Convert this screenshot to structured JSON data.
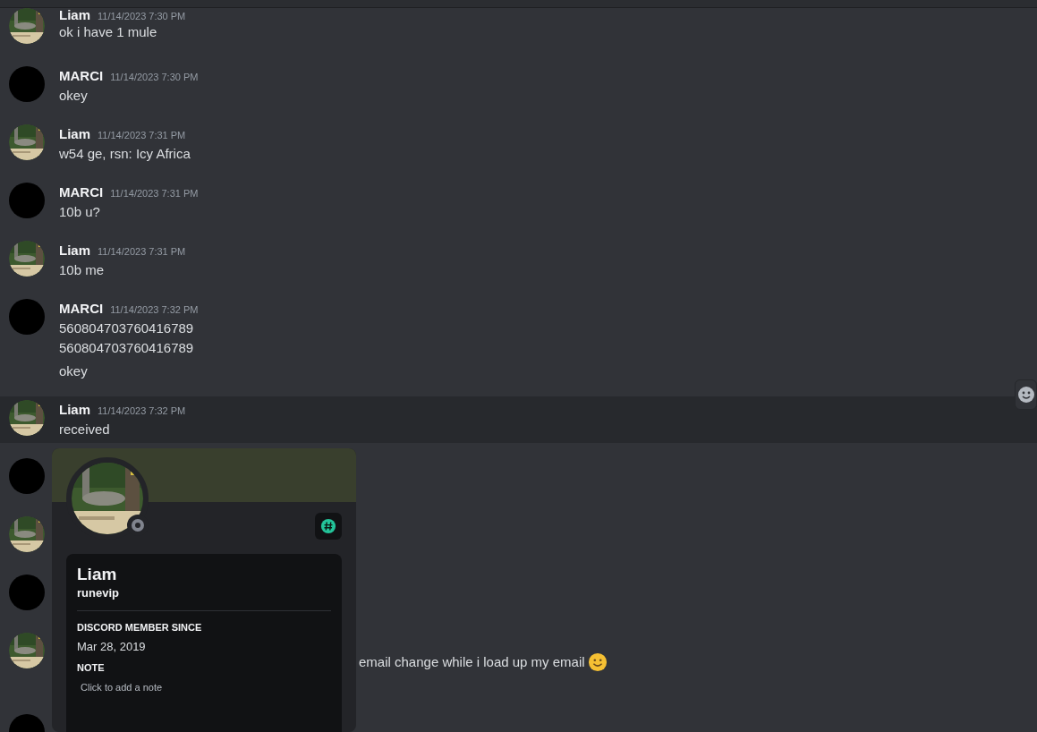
{
  "messages": [
    {
      "kind": "picture",
      "author": "Liam",
      "timestamp": "11/14/2023 7:30 PM",
      "highlighted": false,
      "lines": [
        "ok i have 1 mule"
      ]
    },
    {
      "kind": "plain",
      "author": "MARCI",
      "timestamp": "11/14/2023 7:30 PM",
      "highlighted": false,
      "lines": [
        "okey"
      ]
    },
    {
      "kind": "picture",
      "author": "Liam",
      "timestamp": "11/14/2023 7:31 PM",
      "highlighted": false,
      "lines": [
        "w54 ge, rsn: Icy Africa"
      ]
    },
    {
      "kind": "plain",
      "author": "MARCI",
      "timestamp": "11/14/2023 7:31 PM",
      "highlighted": false,
      "lines": [
        "10b u?"
      ]
    },
    {
      "kind": "picture",
      "author": "Liam",
      "timestamp": "11/14/2023 7:31 PM",
      "highlighted": false,
      "lines": [
        "10b me"
      ]
    },
    {
      "kind": "plain",
      "author": "MARCI",
      "timestamp": "11/14/2023 7:32 PM",
      "highlighted": false,
      "lines": [
        "560804703760416789",
        "560804703760416789"
      ],
      "followups": [
        "okey"
      ]
    },
    {
      "kind": "picture",
      "author": "Liam",
      "timestamp": "11/14/2023 7:32 PM",
      "highlighted": true,
      "lines": [
        "received"
      ]
    },
    {
      "kind": "plain",
      "highlighted": false
    },
    {
      "kind": "picture",
      "highlighted": false
    },
    {
      "kind": "plain",
      "highlighted": false
    },
    {
      "kind": "picture",
      "highlighted": false,
      "covered_lines": [
        "email change while i load up my email"
      ],
      "trailing_emoji": true
    },
    {
      "kind": "plain",
      "highlighted": false
    }
  ],
  "profile_popup": {
    "display_name": "Liam",
    "username": "runevip",
    "online": false,
    "sections": [
      {
        "kind": "text",
        "heading": "DISCORD MEMBER SINCE",
        "value": "Mar 28, 2019"
      },
      {
        "kind": "note",
        "heading": "NOTE",
        "placeholder": "Click to add a note"
      }
    ]
  }
}
